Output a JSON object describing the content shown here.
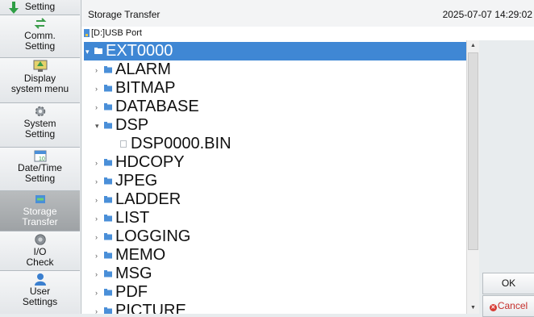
{
  "sidebar": {
    "items": [
      {
        "label": "Setting",
        "icon": "setting-icon"
      },
      {
        "label": "Comm.\nSetting",
        "icon": "comm-icon"
      },
      {
        "label": "Display\nsystem menu",
        "icon": "display-icon"
      },
      {
        "label": "System\nSetting",
        "icon": "gear-icon"
      },
      {
        "label": "Date/Time\nSetting",
        "icon": "calendar-icon"
      },
      {
        "label": "Storage\nTransfer",
        "icon": "storage-transfer-icon",
        "active": true
      },
      {
        "label": "I/O\nCheck",
        "icon": "io-check-icon"
      },
      {
        "label": "User\nSettings",
        "icon": "user-icon"
      }
    ]
  },
  "header": {
    "title": "Storage Transfer",
    "datetime": "2025-07-07 14:29:02"
  },
  "path": {
    "label": "[D:]USB Port"
  },
  "tree": {
    "root": {
      "label": "EXT0000",
      "expanded": true,
      "selected": true
    },
    "nodes": [
      {
        "label": "ALARM",
        "type": "folder",
        "expanded": false,
        "depth": 1
      },
      {
        "label": "BITMAP",
        "type": "folder",
        "expanded": false,
        "depth": 1
      },
      {
        "label": "DATABASE",
        "type": "folder",
        "expanded": false,
        "depth": 1
      },
      {
        "label": "DSP",
        "type": "folder",
        "expanded": true,
        "depth": 1
      },
      {
        "label": "DSP0000.BIN",
        "type": "file",
        "depth": 2
      },
      {
        "label": "HDCOPY",
        "type": "folder",
        "expanded": false,
        "depth": 1
      },
      {
        "label": "JPEG",
        "type": "folder",
        "expanded": false,
        "depth": 1
      },
      {
        "label": "LADDER",
        "type": "folder",
        "expanded": false,
        "depth": 1
      },
      {
        "label": "LIST",
        "type": "folder",
        "expanded": false,
        "depth": 1
      },
      {
        "label": "LOGGING",
        "type": "folder",
        "expanded": false,
        "depth": 1
      },
      {
        "label": "MEMO",
        "type": "folder",
        "expanded": false,
        "depth": 1
      },
      {
        "label": "MSG",
        "type": "folder",
        "expanded": false,
        "depth": 1
      },
      {
        "label": "PDF",
        "type": "folder",
        "expanded": false,
        "depth": 1
      },
      {
        "label": "PICTURE",
        "type": "folder",
        "expanded": false,
        "depth": 1
      }
    ]
  },
  "buttons": {
    "ok": "OK",
    "cancel": "Cancel"
  },
  "colors": {
    "selection": "#3f87d4",
    "folder": "#4a8fd8",
    "cancel": "#c6302c"
  }
}
